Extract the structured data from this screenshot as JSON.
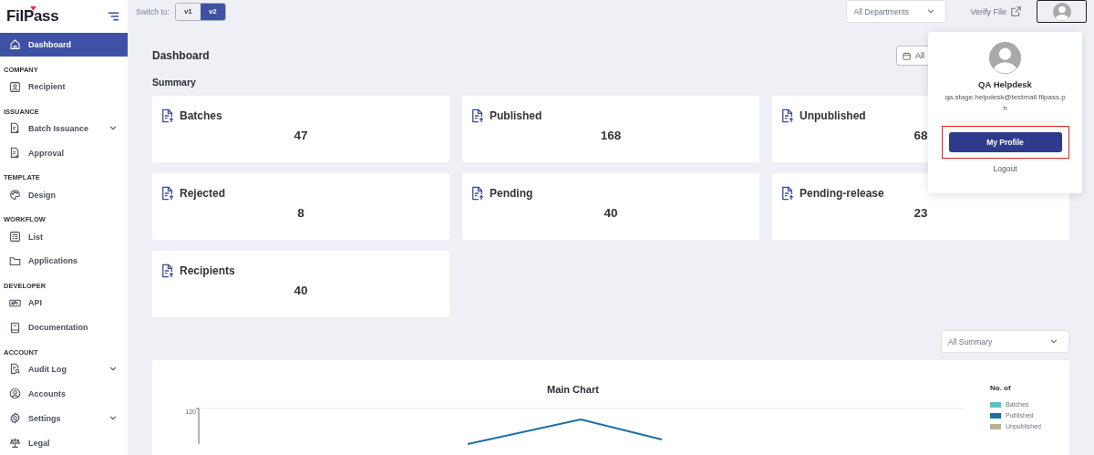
{
  "brand": {
    "name": "FilPass"
  },
  "topbar": {
    "switch_label": "Switch to:",
    "versions": [
      {
        "label": "v1",
        "selected": false
      },
      {
        "label": "v2",
        "selected": true
      }
    ],
    "department_select": "All Departments",
    "verify_link": "Verify File"
  },
  "sidebar": {
    "sections": [
      {
        "items": [
          {
            "label": "Dashboard",
            "kind": "home",
            "expandable": false,
            "selected": true
          }
        ]
      },
      {
        "heading": "COMPANY",
        "items": [
          {
            "label": "Recipient",
            "kind": "user-square",
            "expandable": false,
            "selected": false
          }
        ]
      },
      {
        "heading": "ISSUANCE",
        "items": [
          {
            "label": "Batch Issuance",
            "kind": "doc-plus",
            "expandable": true,
            "selected": false
          },
          {
            "label": "Approval",
            "kind": "doc-check",
            "expandable": false,
            "selected": false
          }
        ]
      },
      {
        "heading": "TEMPLATE",
        "items": [
          {
            "label": "Design",
            "kind": "palette",
            "expandable": false,
            "selected": false
          }
        ]
      },
      {
        "heading": "WORKFLOW",
        "items": [
          {
            "label": "List",
            "kind": "list",
            "expandable": false,
            "selected": false
          },
          {
            "label": "Applications",
            "kind": "folder",
            "expandable": false,
            "selected": false
          }
        ]
      },
      {
        "heading": "DEVELOPER",
        "items": [
          {
            "label": "API",
            "kind": "api",
            "expandable": false,
            "selected": false
          },
          {
            "label": "Documentation",
            "kind": "book",
            "expandable": false,
            "selected": false
          }
        ]
      },
      {
        "heading": "ACCOUNT",
        "items": [
          {
            "label": "Audit Log",
            "kind": "doc-search",
            "expandable": true,
            "selected": false
          },
          {
            "label": "Accounts",
            "kind": "user-circle",
            "expandable": false,
            "selected": false
          },
          {
            "label": "Settings",
            "kind": "gear",
            "expandable": true,
            "selected": false
          },
          {
            "label": "Legal",
            "kind": "scale",
            "expandable": false,
            "selected": false
          }
        ]
      }
    ]
  },
  "page": {
    "title": "Dashboard",
    "date_filter": "All",
    "summary_heading": "Summary"
  },
  "cards": [
    {
      "label": "Batches",
      "value": "47"
    },
    {
      "label": "Published",
      "value": "168"
    },
    {
      "label": "Unpublished",
      "value": "68"
    },
    {
      "label": "Rejected",
      "value": "8"
    },
    {
      "label": "Pending",
      "value": "40"
    },
    {
      "label": "Pending-release",
      "value": "23"
    },
    {
      "label": "Recipients",
      "value": "40"
    }
  ],
  "summary_select": "All Summary",
  "chart": {
    "title": "Main Chart",
    "y_tick": "120",
    "legend_title": "No. of",
    "legend": [
      {
        "label": "Batches",
        "color": "#5bc4c0"
      },
      {
        "label": "Published",
        "color": "#1f6fa0"
      },
      {
        "label": "Unpublished",
        "color": "#b9b48c"
      }
    ]
  },
  "profile_menu": {
    "name": "QA Helpdesk",
    "email": "qa.stage.helpdesk@testmail.filpass.ph",
    "profile_button": "My Profile",
    "logout": "Logout"
  }
}
